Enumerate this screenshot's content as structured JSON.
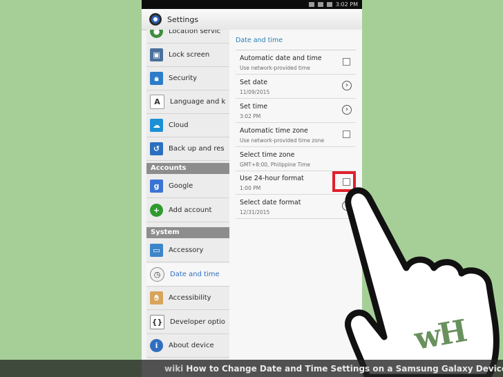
{
  "statusbar": {
    "time": "3:02 PM"
  },
  "actionbar": {
    "title": "Settings"
  },
  "left_pane": {
    "items": [
      {
        "label": "Location servic",
        "icon": "location-icon",
        "color": "#3f8e3c"
      },
      {
        "label": "Lock screen",
        "icon": "lock-screen-icon",
        "color": "#4a6f9b"
      },
      {
        "label": "Security",
        "icon": "padlock-icon",
        "color": "#2c7cc9"
      },
      {
        "label": "Language and k",
        "icon": "letter-a-icon",
        "color": "#555555"
      },
      {
        "label": "Cloud",
        "icon": "cloud-icon",
        "color": "#1c8fd6"
      },
      {
        "label": "Back up and res",
        "icon": "backup-icon",
        "color": "#2a6fbf"
      },
      {
        "label": "Google",
        "icon": "google-icon",
        "color": "#3b74d4"
      },
      {
        "label": "Add account",
        "icon": "add-icon",
        "color": "#2f9a2f"
      },
      {
        "label": "Accessory",
        "icon": "accessory-icon",
        "color": "#3c85c8"
      },
      {
        "label": "Date and time",
        "icon": "clock-icon",
        "color": "#e8e8e8"
      },
      {
        "label": "Accessibility",
        "icon": "hand-icon",
        "color": "#d8a45c"
      },
      {
        "label": "Developer optio",
        "icon": "braces-icon",
        "color": "#444444"
      },
      {
        "label": "About device",
        "icon": "info-icon",
        "color": "#2f6fc0"
      }
    ],
    "section_accounts": "Accounts",
    "section_system": "System"
  },
  "right_pane": {
    "header": "Date and time",
    "rows": [
      {
        "title": "Automatic date and time",
        "subtitle": "Use network-provided time",
        "control": "checkbox"
      },
      {
        "title": "Set date",
        "subtitle": "11/09/2015",
        "control": "arrow"
      },
      {
        "title": "Set time",
        "subtitle": "3:02 PM",
        "control": "arrow"
      },
      {
        "title": "Automatic time zone",
        "subtitle": "Use network-provided time zone",
        "control": "checkbox"
      },
      {
        "title": "Select time zone",
        "subtitle": "GMT+8:00, Philippine Time",
        "control": "none"
      },
      {
        "title": "Use 24-hour format",
        "subtitle": "1:00 PM",
        "control": "checkbox"
      },
      {
        "title": "Select date format",
        "subtitle": "12/31/2015",
        "control": "arrow"
      }
    ]
  },
  "caption": {
    "brand": "wiki",
    "text": "How to Change Date and Time Settings on a Samsung Galaxy Device"
  },
  "watermark": "wH",
  "colors": {
    "background": "#a6cf98",
    "highlight": "#e0202c",
    "header_accent": "#2a7fb4"
  }
}
